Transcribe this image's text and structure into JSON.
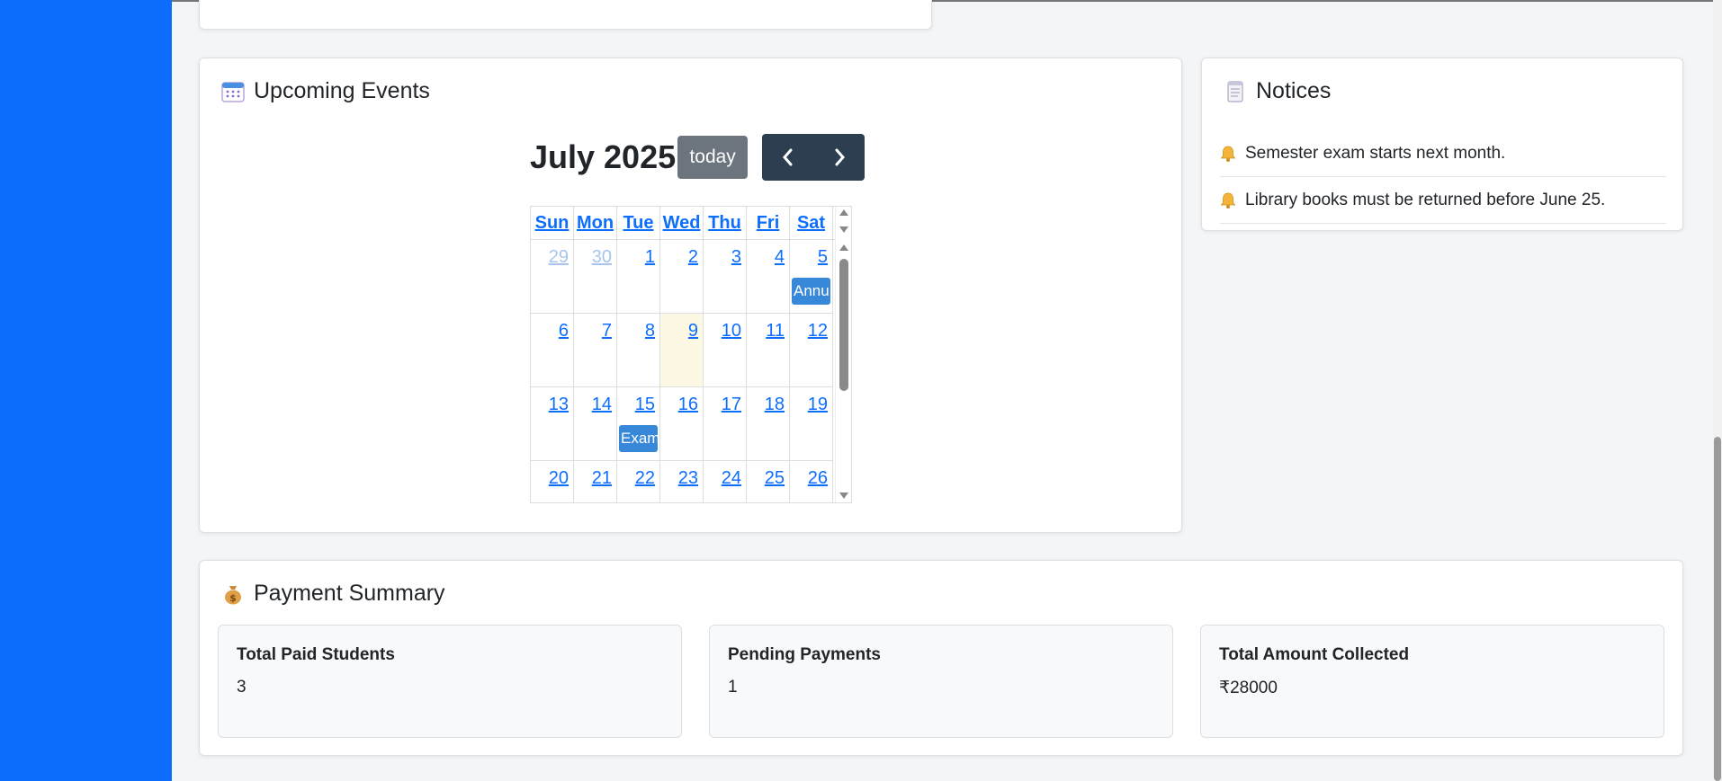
{
  "events": {
    "title": "Upcoming Events",
    "calendar": {
      "month_title": "July 2025",
      "today_label": "today",
      "weekdays": [
        "Sun",
        "Mon",
        "Tue",
        "Wed",
        "Thu",
        "Fri",
        "Sat"
      ],
      "weeks": [
        [
          {
            "day": "29",
            "other": true
          },
          {
            "day": "30",
            "other": true
          },
          {
            "day": "1"
          },
          {
            "day": "2"
          },
          {
            "day": "3"
          },
          {
            "day": "4"
          },
          {
            "day": "5",
            "event": "Annu"
          }
        ],
        [
          {
            "day": "6"
          },
          {
            "day": "7"
          },
          {
            "day": "8"
          },
          {
            "day": "9",
            "today": true
          },
          {
            "day": "10"
          },
          {
            "day": "11"
          },
          {
            "day": "12"
          }
        ],
        [
          {
            "day": "13"
          },
          {
            "day": "14"
          },
          {
            "day": "15",
            "event": "Exam"
          },
          {
            "day": "16"
          },
          {
            "day": "17"
          },
          {
            "day": "18"
          },
          {
            "day": "19"
          }
        ],
        [
          {
            "day": "20"
          },
          {
            "day": "21"
          },
          {
            "day": "22"
          },
          {
            "day": "23"
          },
          {
            "day": "24"
          },
          {
            "day": "25"
          },
          {
            "day": "26"
          }
        ]
      ]
    }
  },
  "notices": {
    "title": "Notices",
    "items": [
      "Semester exam starts next month.",
      "Library books must be returned before June 25."
    ]
  },
  "payment": {
    "title": "Payment Summary",
    "stats": [
      {
        "label": "Total Paid Students",
        "value": "3"
      },
      {
        "label": "Pending Payments",
        "value": "1"
      },
      {
        "label": "Total Amount Collected",
        "value": "₹28000"
      }
    ]
  },
  "colors": {
    "sidebar": "#0d6efd",
    "event": "#3788d8",
    "nav_buttons": "#2c3e50",
    "today_button": "#6c757d",
    "today_cell": "#fcf8e3"
  }
}
